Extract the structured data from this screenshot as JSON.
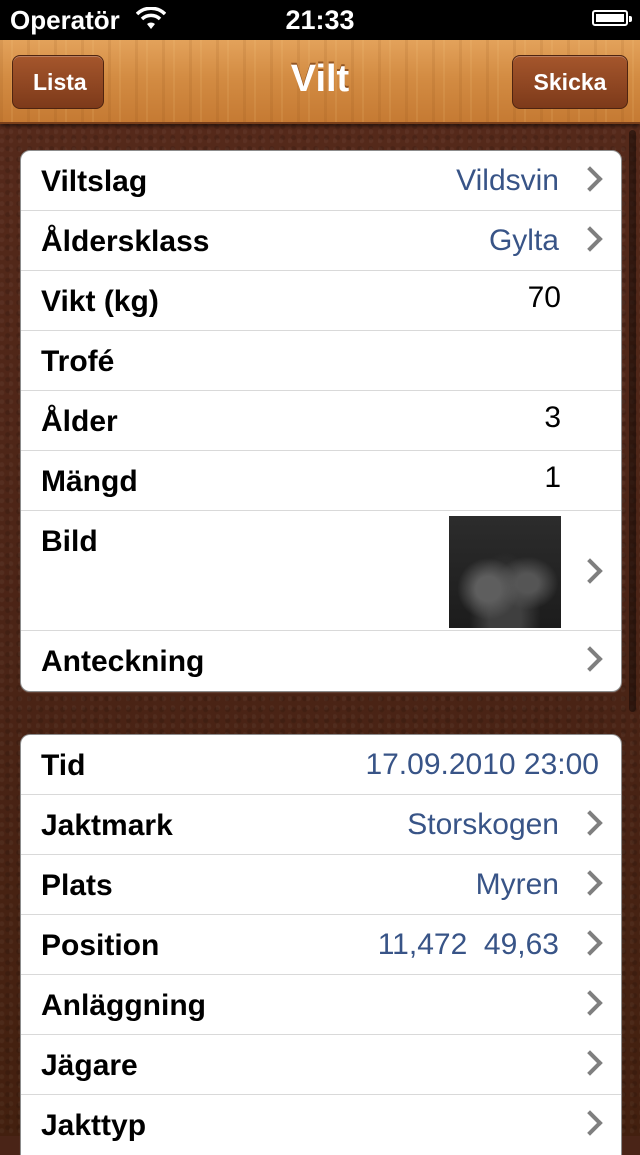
{
  "status_bar": {
    "carrier": "Operatör",
    "time": "21:33"
  },
  "navbar": {
    "back_label": "Lista",
    "title": "Vilt",
    "send_label": "Skicka"
  },
  "section1": {
    "rows": [
      {
        "label": "Viltslag",
        "value": "Vildsvin"
      },
      {
        "label": "Åldersklass",
        "value": "Gylta"
      },
      {
        "label": "Vikt (kg)",
        "value": "70"
      },
      {
        "label": "Trofé",
        "value": ""
      },
      {
        "label": "Ålder",
        "value": "3"
      },
      {
        "label": "Mängd",
        "value": "1"
      },
      {
        "label": "Bild",
        "value": ""
      },
      {
        "label": "Anteckning",
        "value": ""
      }
    ]
  },
  "section2": {
    "rows": [
      {
        "label": "Tid",
        "value": "17.09.2010 23:00"
      },
      {
        "label": "Jaktmark",
        "value": "Storskogen"
      },
      {
        "label": "Plats",
        "value": "Myren"
      },
      {
        "label": "Position",
        "value": "11,472  49,63"
      },
      {
        "label": "Anläggning",
        "value": ""
      },
      {
        "label": "Jägare",
        "value": ""
      },
      {
        "label": "Jakttyp",
        "value": ""
      }
    ]
  },
  "colors": {
    "value_blue": "#385487",
    "leather": "#4b2416",
    "wood": "#d38c43"
  },
  "icons": [
    "wifi-icon",
    "battery-icon",
    "chevron-right-icon"
  ]
}
